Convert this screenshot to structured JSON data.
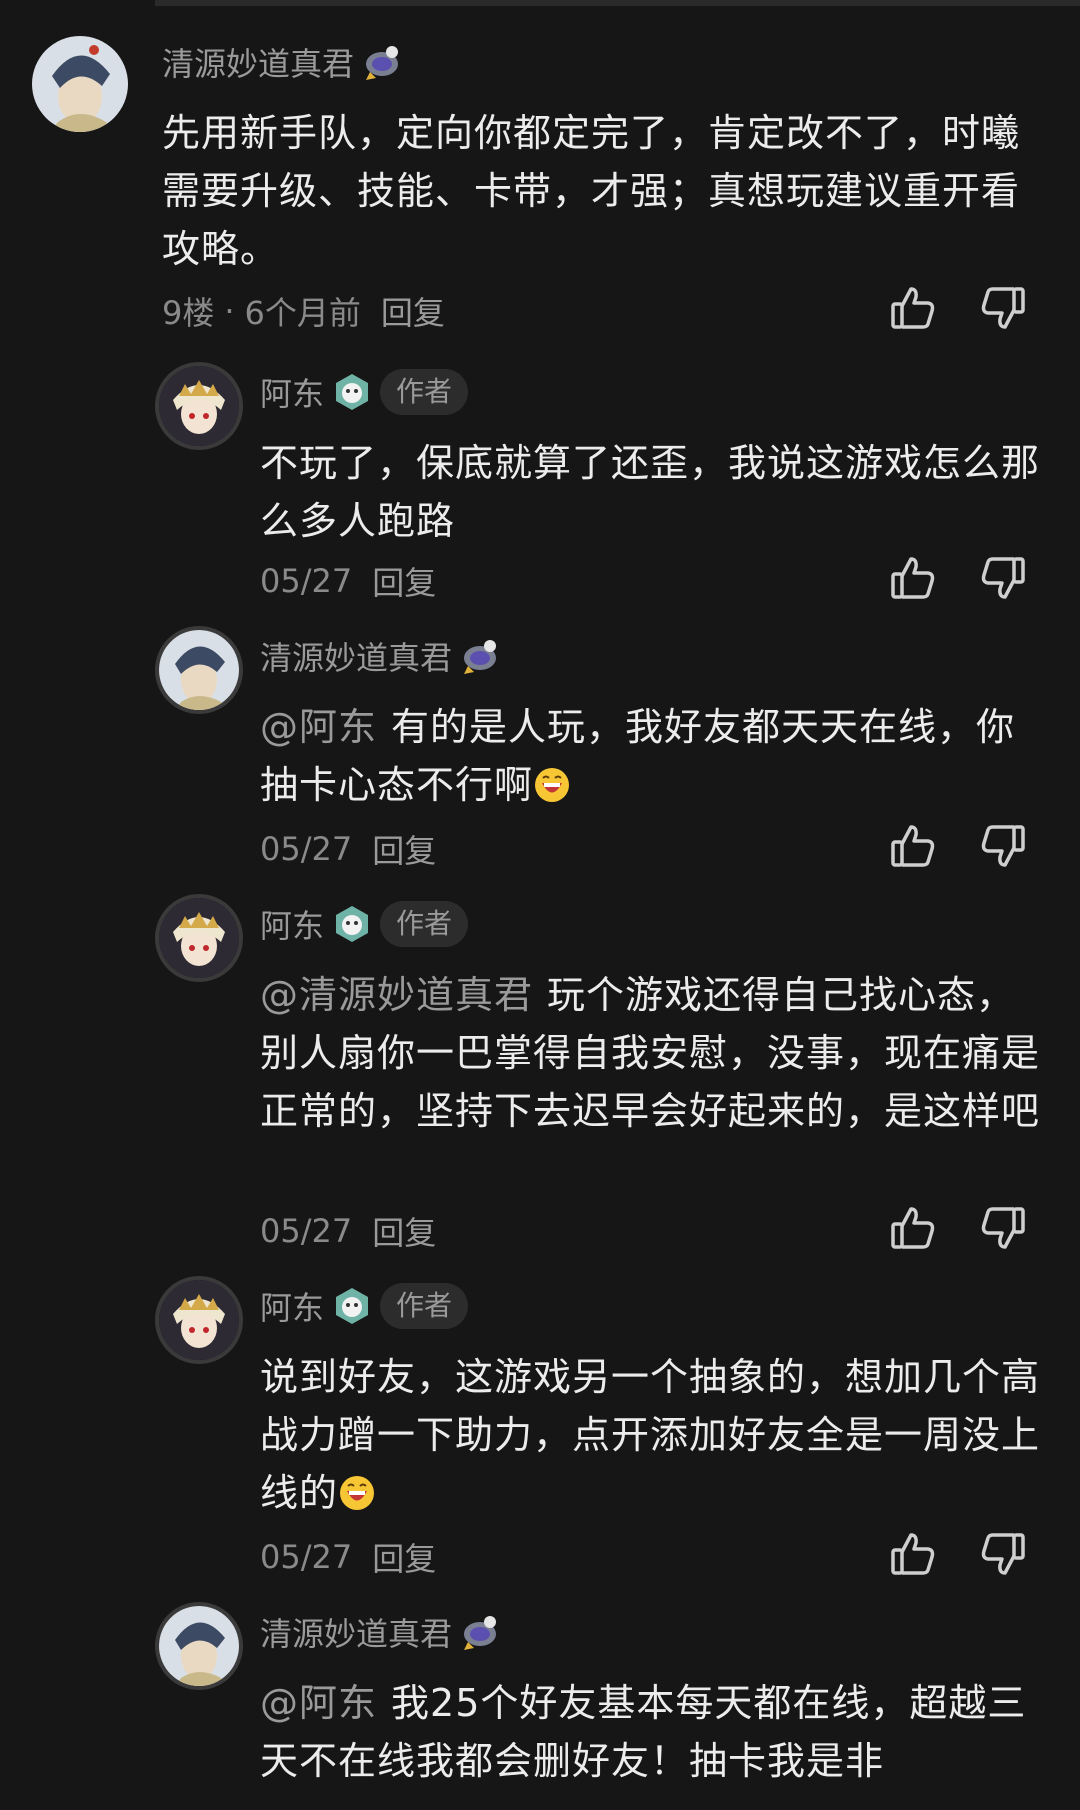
{
  "comments": [
    {
      "user": "清源妙道真君",
      "text": "先用新手队，定向你都定完了，肯定改不了，时曦需要升级、技能、卡带，才强；真想玩建议重开看攻略。",
      "floor": "9楼",
      "sep": "·",
      "time": "6个月前",
      "reply": "回复"
    },
    {
      "user": "阿东",
      "tag": "作者",
      "text": "不玩了，保底就算了还歪，我说这游戏怎么那么多人跑路",
      "time": "05/27",
      "reply": "回复"
    },
    {
      "user": "清源妙道真君",
      "mention": "@阿东",
      "text": "有的是人玩，我好友都天天在线，你抽卡心态不行啊",
      "time": "05/27",
      "reply": "回复"
    },
    {
      "user": "阿东",
      "tag": "作者",
      "mention": "@清源妙道真君",
      "text": "玩个游戏还得自己找心态，别人扇你一巴掌得自我安慰，没事，现在痛是正常的，坚持下去迟早会好起来的，是这样吧",
      "time": "05/27",
      "reply": "回复"
    },
    {
      "user": "阿东",
      "tag": "作者",
      "text": "说到好友，这游戏另一个抽象的，想加几个高战力蹭一下助力，点开添加好友全是一周没上线的",
      "time": "05/27",
      "reply": "回复"
    },
    {
      "user": "清源妙道真君",
      "mention": "@阿东",
      "text": "我25个好友基本每天都在线，超越三天不在线我都会删好友！抽卡我是非"
    }
  ],
  "icons": {
    "like": "thumbs-up-icon",
    "dislike": "thumbs-down-icon",
    "user_badge": "rocket-badge-icon",
    "author_badge": "tiger-badge-icon",
    "emoji": "grinning-face-emoji"
  },
  "colors": {
    "background": "#161616",
    "text": "#ececec",
    "muted": "#9a9a9a"
  }
}
